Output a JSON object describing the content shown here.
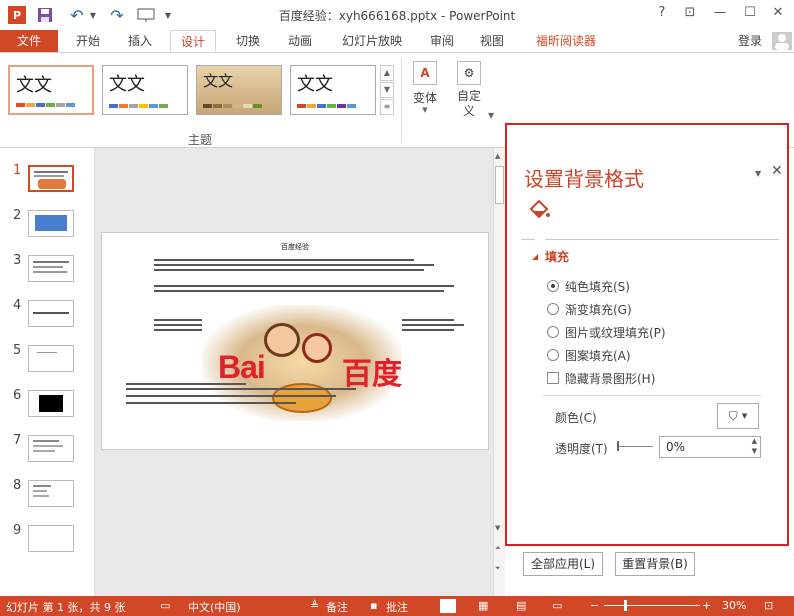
{
  "app": {
    "title": "百度经验：xyh666168.pptx - PowerPoint",
    "login": "登录"
  },
  "quick_access": {
    "icons": [
      "powerpoint-logo-icon",
      "save-icon",
      "undo-icon",
      "redo-icon",
      "present-icon",
      "customize-icon"
    ],
    "undo_glyph": "↶",
    "redo_glyph": "↷"
  },
  "window": {
    "help": "?",
    "restore_ribbon": "⊡",
    "minimize": "—",
    "maximize": "☐",
    "close": "✕"
  },
  "tabs": {
    "file": "文件",
    "home": "开始",
    "insert": "插入",
    "design": "设计",
    "transitions": "切换",
    "animations": "动画",
    "slideshow": "幻灯片放映",
    "review": "审阅",
    "view": "视图",
    "foxit": "福昕阅读器"
  },
  "ribbon": {
    "theme_sample": "文文",
    "theme_group_label": "主题",
    "variants_label": "变体",
    "customize_label": "自定\n义",
    "variants_glyph": "A",
    "customize_glyph": "⚙",
    "colors": [
      "#e8472b",
      "#f2a33a",
      "#4472c4",
      "#70ad47",
      "#a5a5a5",
      "#5b9bd5"
    ]
  },
  "slides": {
    "numbers": [
      "1",
      "2",
      "3",
      "4",
      "5",
      "6",
      "7",
      "8",
      "9"
    ],
    "main_title": "百度经验"
  },
  "pane": {
    "title": "设置背景格式",
    "section": "填充",
    "options": [
      "纯色填充(S)",
      "渐变填充(G)",
      "图片或纹理填充(P)",
      "图案填充(A)"
    ],
    "selected_index": 0,
    "hide_bg": "隐藏背景图形(H)",
    "color_label": "颜色(C)",
    "transparency_label": "透明度(T)",
    "transparency_value": "0%",
    "apply_all": "全部应用(L)",
    "reset": "重置背景(B)"
  },
  "status": {
    "slide_info": "幻灯片 第 1 张，共 9 张",
    "language": "中文(中国)",
    "notes": "备注",
    "comments": "批注",
    "zoom": "30%"
  },
  "accent": "#d24726",
  "highlight_box": "#e02020"
}
